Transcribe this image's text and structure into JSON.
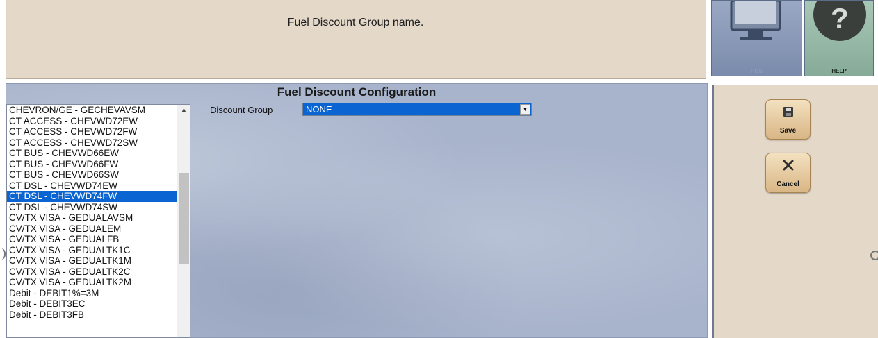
{
  "info_bar": {
    "text": "Fuel Discount Group name."
  },
  "tiles": {
    "pos_label": "POS",
    "help_label": "HELP"
  },
  "panel": {
    "title": "Fuel Discount Configuration"
  },
  "discount_group": {
    "label": "Discount Group",
    "value": "NONE"
  },
  "list": {
    "items": [
      "CHEVRON/GE - GECHEVAVSM",
      "CT ACCESS - CHEVWD72EW",
      "CT ACCESS - CHEVWD72FW",
      "CT ACCESS - CHEVWD72SW",
      "CT BUS - CHEVWD66EW",
      "CT BUS - CHEVWD66FW",
      "CT BUS - CHEVWD66SW",
      "CT DSL - CHEVWD74EW",
      "CT DSL - CHEVWD74FW",
      "CT DSL - CHEVWD74SW",
      "CV/TX VISA - GEDUALAVSM",
      "CV/TX VISA - GEDUALEM",
      "CV/TX VISA - GEDUALFB",
      "CV/TX VISA - GEDUALTK1C",
      "CV/TX VISA - GEDUALTK1M",
      "CV/TX VISA - GEDUALTK2C",
      "CV/TX VISA - GEDUALTK2M",
      "Debit - DEBIT1%=3M",
      "Debit - DEBIT3EC",
      "Debit - DEBIT3FB"
    ],
    "selected_index": 8
  },
  "actions": {
    "save_label": "Save",
    "cancel_label": "Cancel"
  },
  "icons": {
    "save": "save-icon",
    "cancel": "cancel-icon",
    "pos": "monitor-icon",
    "help": "help-icon"
  }
}
